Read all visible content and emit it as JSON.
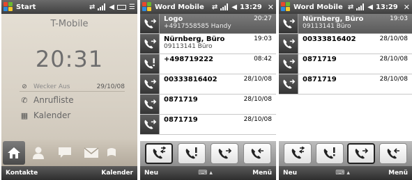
{
  "colors": {
    "titlebar": "#4a4a4a",
    "selected_row": "#6b6b6b",
    "home_bg": "#ddd6ca"
  },
  "screen1": {
    "title": "Start",
    "operator": "T-Mobile",
    "clock": "20:31",
    "alarm": "Wecker Aus",
    "date": "29/10/08",
    "item1": "Anrufliste",
    "item2": "Kalender",
    "softkey_left": "Kontakte",
    "softkey_right": "Kalender"
  },
  "screen2": {
    "title": "Word Mobile",
    "time": "13:29",
    "close": "✕",
    "softkey_left": "Neu",
    "softkey_right": "Menü",
    "rows": [
      {
        "name": "Logo",
        "sub": "+4917558585 Handy",
        "time": "20:27",
        "icon": "outgoing-call-icon"
      },
      {
        "name": "Nürnberg, Büro",
        "sub": "09113141 Büro",
        "time": "19:03",
        "icon": "outgoing-call-icon"
      },
      {
        "name": "+498719222",
        "sub": "",
        "time": "08:42",
        "icon": "missed-call-icon"
      },
      {
        "name": "00333816402",
        "sub": "",
        "time": "28/10/08",
        "icon": "outgoing-call-icon"
      },
      {
        "name": "0871719",
        "sub": "",
        "time": "28/10/08",
        "icon": "outgoing-call-icon"
      },
      {
        "name": "0871719",
        "sub": "",
        "time": "28/10/08",
        "icon": "outgoing-call-icon"
      }
    ]
  },
  "screen3": {
    "title": "Word Mobile",
    "time": "13:29",
    "close": "✕",
    "softkey_left": "Neu",
    "softkey_right": "Menü",
    "rows": [
      {
        "name": "Nürnberg, Büro",
        "sub": "09113141 Büro",
        "time": "19:03",
        "icon": "outgoing-call-icon"
      },
      {
        "name": "00333816402",
        "sub": "",
        "time": "28/10/08",
        "icon": "outgoing-call-icon"
      },
      {
        "name": "0871719",
        "sub": "",
        "time": "28/10/08",
        "icon": "outgoing-call-icon"
      },
      {
        "name": "0871719",
        "sub": "",
        "time": "28/10/08",
        "icon": "outgoing-call-icon"
      }
    ]
  },
  "tabs": [
    "all-calls-tab",
    "missed-calls-tab",
    "outgoing-calls-tab",
    "incoming-calls-tab"
  ]
}
